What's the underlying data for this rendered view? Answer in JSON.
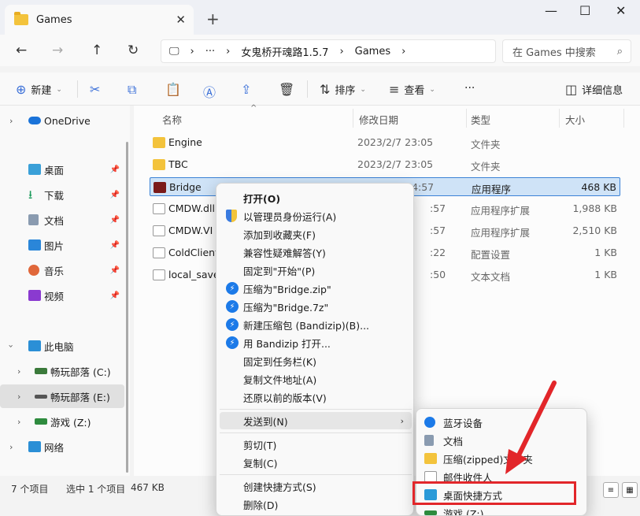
{
  "window": {
    "tab_title": "Games",
    "new_tab": "+",
    "minimize": "—",
    "maximize": "☐",
    "close": "✕"
  },
  "address": {
    "crumbs": [
      "女鬼桥开魂路1.5.7",
      "Games"
    ],
    "ellipsis": "···",
    "search_placeholder": "在 Games 中搜索"
  },
  "toolbar": {
    "new_label": "新建",
    "sort_label": "排序",
    "view_label": "查看",
    "details_label": "详细信息"
  },
  "sidebar": {
    "items": [
      {
        "label": "OneDrive"
      },
      {
        "label": "桌面"
      },
      {
        "label": "下载"
      },
      {
        "label": "文档"
      },
      {
        "label": "图片"
      },
      {
        "label": "音乐"
      },
      {
        "label": "视频"
      },
      {
        "label": "此电脑"
      },
      {
        "label": "畅玩部落 (C:)"
      },
      {
        "label": "畅玩部落 (E:)"
      },
      {
        "label": "游戏 (Z:)"
      },
      {
        "label": "网络"
      }
    ]
  },
  "columns": {
    "name": "名称",
    "date": "修改日期",
    "type": "类型",
    "size": "大小"
  },
  "files": [
    {
      "name": "Engine",
      "date": "2023/2/7 23:05",
      "type": "文件夹",
      "size": ""
    },
    {
      "name": "TBC",
      "date": "2023/2/7 23:05",
      "type": "文件夹",
      "size": ""
    },
    {
      "name": "Bridge",
      "date": "2023/2/7 14:57",
      "type": "应用程序",
      "size": "468 KB"
    },
    {
      "name": "CMDW.dll",
      "date": ":57",
      "type": "应用程序扩展",
      "size": "1,988 KB"
    },
    {
      "name": "CMDW.VI",
      "date": ":57",
      "type": "应用程序扩展",
      "size": "2,510 KB"
    },
    {
      "name": "ColdClient",
      "date": ":22",
      "type": "配置设置",
      "size": "1 KB"
    },
    {
      "name": "local_save",
      "date": ":50",
      "type": "文本文档",
      "size": "1 KB"
    }
  ],
  "status": {
    "count": "7 个项目",
    "selected": "选中 1 个项目",
    "size": "467 KB"
  },
  "context_menu": {
    "items": [
      "打开(O)",
      "以管理员身份运行(A)",
      "添加到收藏夹(F)",
      "兼容性疑难解答(Y)",
      "固定到\"开始\"(P)",
      "压缩为\"Bridge.zip\"",
      "压缩为\"Bridge.7z\"",
      "新建压缩包 (Bandizip)(B)...",
      "用 Bandizip 打开...",
      "固定到任务栏(K)",
      "复制文件地址(A)",
      "还原以前的版本(V)",
      "发送到(N)",
      "剪切(T)",
      "复制(C)",
      "创建快捷方式(S)",
      "删除(D)"
    ]
  },
  "sendto_menu": {
    "items": [
      "蓝牙设备",
      "文档",
      "压缩(zipped)文件夹",
      "邮件收件人",
      "桌面快捷方式",
      "游戏 (Z:)"
    ]
  },
  "colors": {
    "highlight_red": "#e2262a",
    "accent_blue": "#1c7ae8"
  }
}
